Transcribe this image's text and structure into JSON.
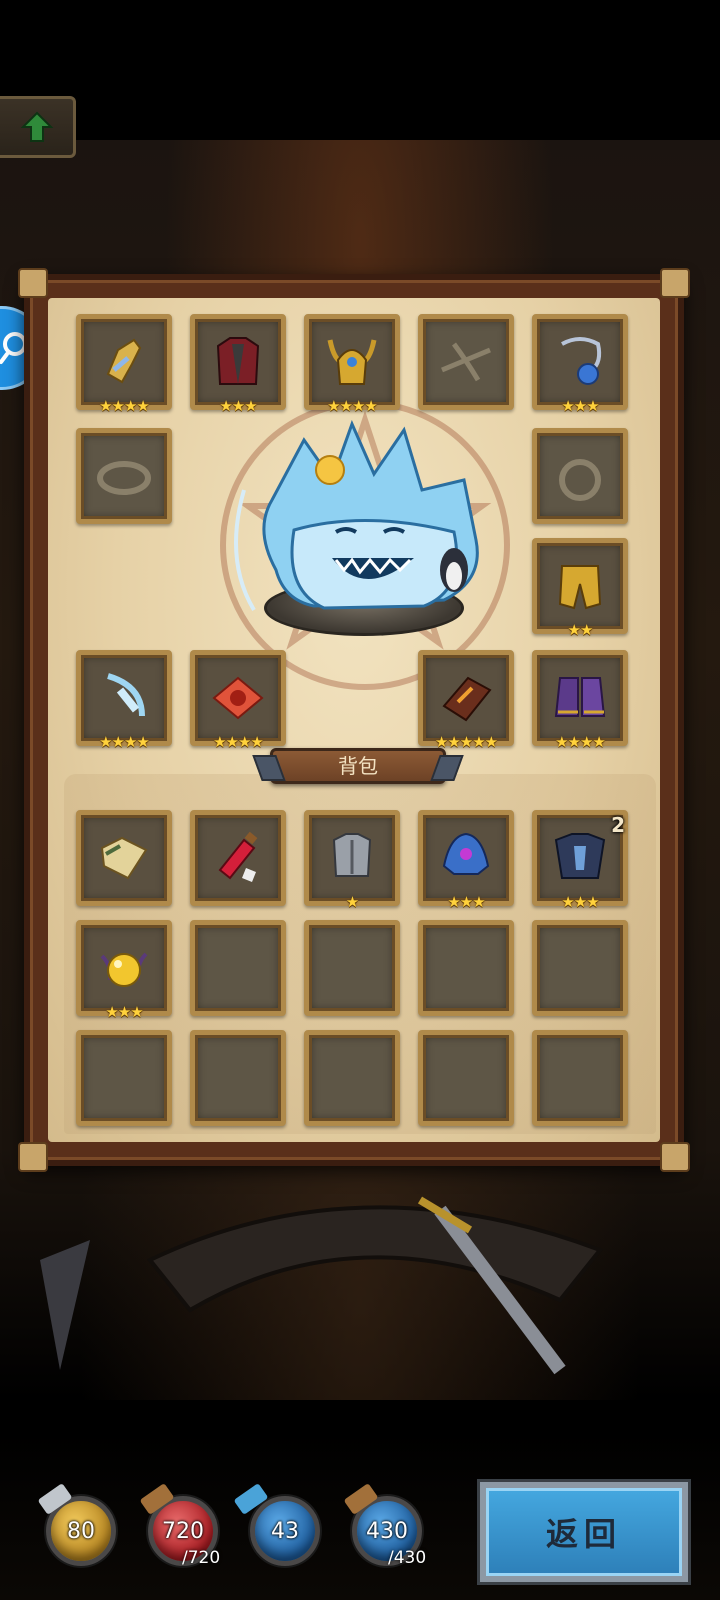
{
  "inventory": {
    "bag_title": "背包",
    "equipped": [
      {
        "name": "golden-gauntlet",
        "stars": "★★★★"
      },
      {
        "name": "crimson-armor",
        "stars": "★★★"
      },
      {
        "name": "horned-helmet",
        "stars": "★★★★"
      },
      {
        "name": "empty-weapon-slot",
        "stars": ""
      },
      {
        "name": "sapphire-amulet",
        "stars": "★★★"
      },
      {
        "name": "empty-bracelet-slot",
        "stars": ""
      },
      {
        "name": "empty-ring-slot",
        "stars": ""
      },
      {
        "name": "golden-leg-armor",
        "stars": "★★"
      },
      {
        "name": "ice-bow",
        "stars": "★★★★"
      },
      {
        "name": "ruby-rune",
        "stars": "★★★★"
      },
      {
        "name": "fire-tome",
        "stars": "★★★★★"
      },
      {
        "name": "purple-boots",
        "stars": "★★★★"
      }
    ],
    "bag_items": [
      {
        "name": "treasure-map",
        "stars": "",
        "qty": ""
      },
      {
        "name": "red-potion",
        "stars": "",
        "qty": ""
      },
      {
        "name": "steel-breastplate",
        "stars": "★",
        "qty": ""
      },
      {
        "name": "blue-helm",
        "stars": "★★★",
        "qty": ""
      },
      {
        "name": "dark-armor",
        "stars": "★★★",
        "qty": "2"
      },
      {
        "name": "golden-orb",
        "stars": "★★★",
        "qty": ""
      }
    ]
  },
  "stats": {
    "attack": {
      "value": "80",
      "color": "#d2a133"
    },
    "hp": {
      "value": "720",
      "max": "/720",
      "color": "#c4282c"
    },
    "defense": {
      "value": "43",
      "color": "#2c6fb2"
    },
    "mp": {
      "value": "430",
      "max": "/430",
      "color": "#2c6fb2"
    }
  },
  "buttons": {
    "return_label": "返回",
    "up_icon": "arrow-up-icon",
    "search_icon": "search-icon"
  }
}
